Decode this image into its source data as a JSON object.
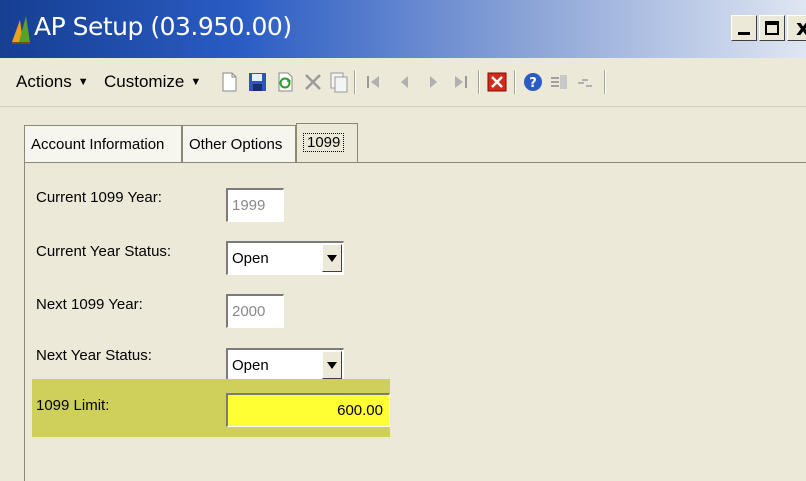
{
  "window": {
    "title": "AP Setup (03.950.00)",
    "logo_icon": "app-logo-icon",
    "buttons": [
      "minimize-icon",
      "maximize-icon",
      "close-icon"
    ]
  },
  "toolbar": {
    "actions_label": "Actions",
    "customize_label": "Customize",
    "icons": [
      "new-icon",
      "save-icon",
      "refresh-icon",
      "delete-icon",
      "copy-icon",
      "first-icon",
      "previous-icon",
      "next-icon",
      "last-icon",
      "cancel-icon",
      "help-icon",
      "note-icon",
      "link-icon"
    ]
  },
  "tabs": [
    {
      "label": "Account Information"
    },
    {
      "label": "Other Options"
    },
    {
      "label": "1099",
      "active": true
    }
  ],
  "form": {
    "current_year_label": "Current 1099 Year:",
    "current_year_value": "1999",
    "current_status_label": "Current Year Status:",
    "current_status_value": "Open",
    "next_year_label": "Next 1099 Year:",
    "next_year_value": "2000",
    "next_status_label": "Next Year Status:",
    "next_status_value": "Open",
    "limit_label": "1099 Limit:",
    "limit_value": "600.00"
  },
  "colors": {
    "highlight": "#cfd05a",
    "limit_field": "#ffff33",
    "title_gradient_start": "#163f92"
  }
}
